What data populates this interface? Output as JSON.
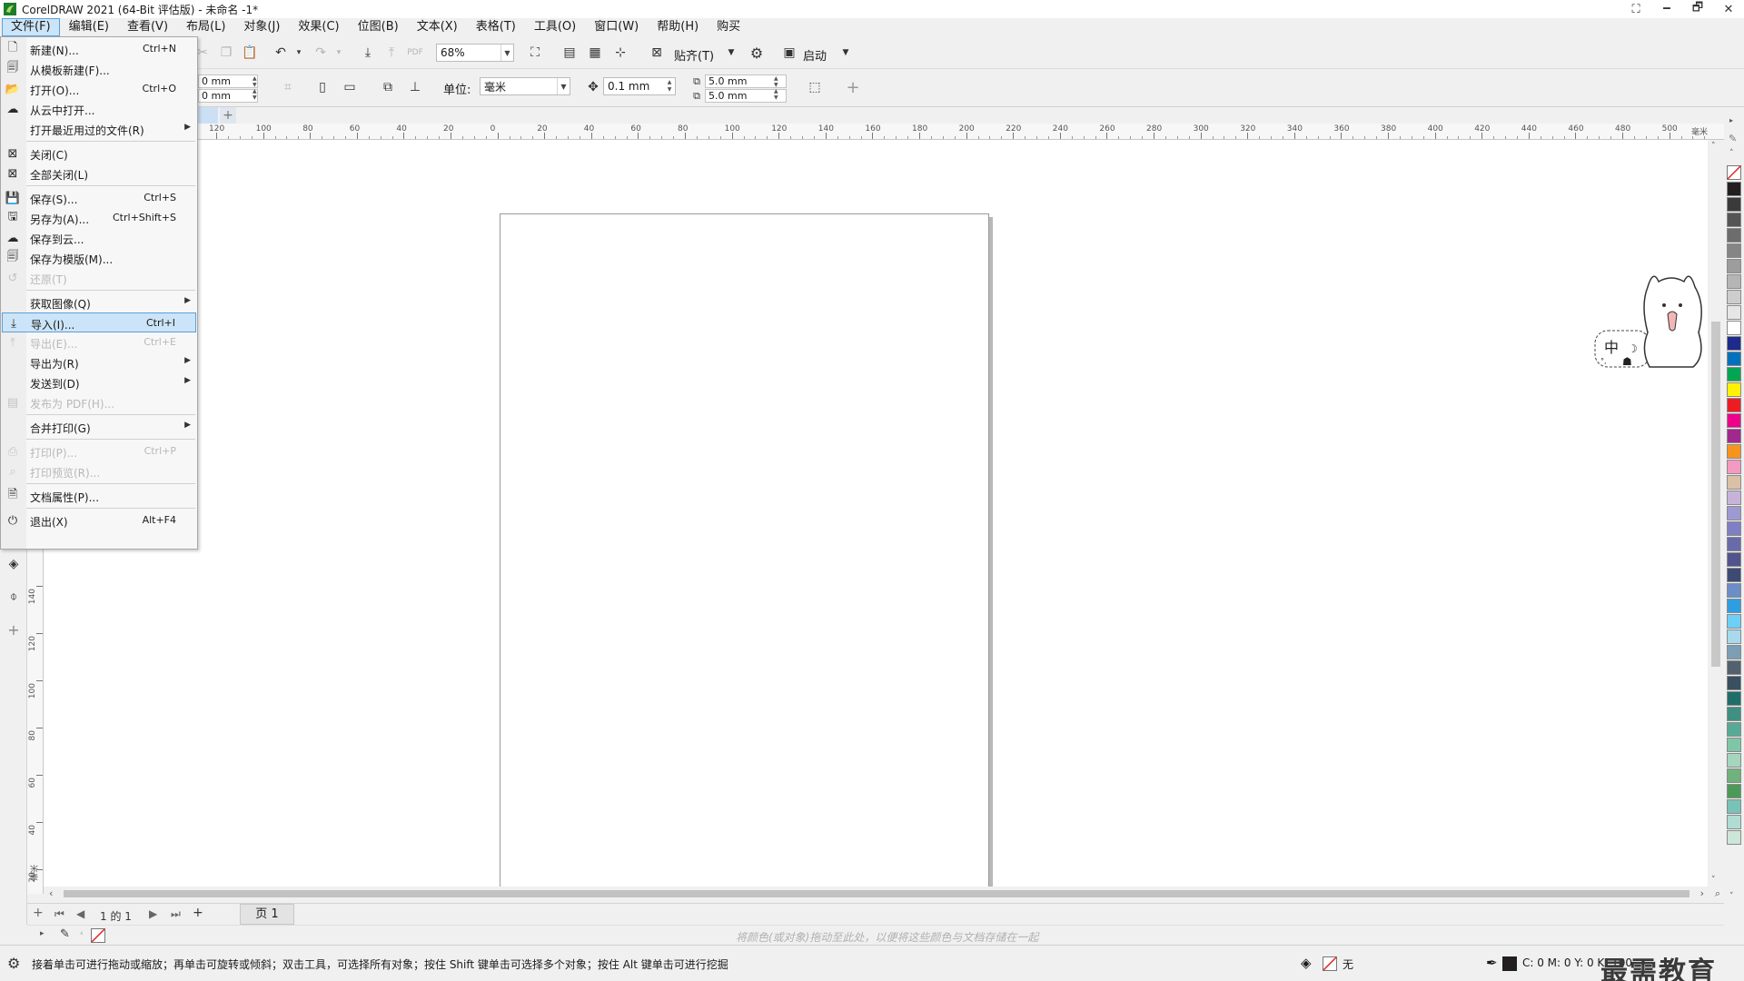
{
  "window": {
    "title": "CorelDRAW 2021 (64-Bit 评估版) - 未命名 -1*",
    "minimize": "🗕",
    "restore": "🗗",
    "close": "✕"
  },
  "menubar": {
    "items": [
      {
        "label": "文件(F)"
      },
      {
        "label": "编辑(E)"
      },
      {
        "label": "查看(V)"
      },
      {
        "label": "布局(L)"
      },
      {
        "label": "对象(J)"
      },
      {
        "label": "效果(C)"
      },
      {
        "label": "位图(B)"
      },
      {
        "label": "文本(X)"
      },
      {
        "label": "表格(T)"
      },
      {
        "label": "工具(O)"
      },
      {
        "label": "窗口(W)"
      },
      {
        "label": "帮助(H)"
      },
      {
        "label": "购买"
      }
    ]
  },
  "toolbar": {
    "zoom": "68%",
    "snap_label": "贴齐(T)",
    "launch_label": "启动"
  },
  "propertybar": {
    "x_value": "0 mm",
    "y_value": "0 mm",
    "unit_label": "单位:",
    "unit_value": "毫米",
    "nudge_value": "0.1 mm",
    "dup_x": "5.0 mm",
    "dup_y": "5.0 mm"
  },
  "ruler": {
    "h_ticks": [
      "120",
      "100",
      "80",
      "60",
      "40",
      "20",
      "0",
      "20",
      "40",
      "60",
      "80",
      "100",
      "120",
      "140",
      "160",
      "180",
      "200",
      "220",
      "240",
      "260",
      "280",
      "300",
      "320",
      "340",
      "360",
      "380",
      "400",
      "420",
      "440",
      "460",
      "480",
      "500"
    ],
    "h_unit": "毫米",
    "v_ticks": [
      "140",
      "120",
      "100",
      "80",
      "60",
      "40",
      "20"
    ],
    "v_unit": "毫米"
  },
  "file_menu": {
    "items": [
      {
        "icon": "new-doc-icon",
        "label": "新建(N)...",
        "shortcut": "Ctrl+N",
        "submenu": false,
        "disabled": false
      },
      {
        "icon": "new-from-template-icon",
        "label": "从模板新建(F)...",
        "shortcut": "",
        "submenu": false,
        "disabled": false
      },
      {
        "icon": "open-folder-icon",
        "label": "打开(O)...",
        "shortcut": "Ctrl+O",
        "submenu": false,
        "disabled": false
      },
      {
        "icon": "cloud-open-icon",
        "label": "从云中打开...",
        "shortcut": "",
        "submenu": false,
        "disabled": false
      },
      {
        "icon": "",
        "label": "打开最近用过的文件(R)",
        "shortcut": "",
        "submenu": true,
        "disabled": false
      },
      {
        "separator": true
      },
      {
        "icon": "close-doc-icon",
        "label": "关闭(C)",
        "shortcut": "",
        "submenu": false,
        "disabled": false
      },
      {
        "icon": "close-all-icon",
        "label": "全部关闭(L)",
        "shortcut": "",
        "submenu": false,
        "disabled": false
      },
      {
        "separator": true
      },
      {
        "icon": "save-icon",
        "label": "保存(S)...",
        "shortcut": "Ctrl+S",
        "submenu": false,
        "disabled": false
      },
      {
        "icon": "save-as-icon",
        "label": "另存为(A)...",
        "shortcut": "Ctrl+Shift+S",
        "submenu": false,
        "disabled": false
      },
      {
        "icon": "cloud-save-icon",
        "label": "保存到云...",
        "shortcut": "",
        "submenu": false,
        "disabled": false
      },
      {
        "icon": "save-template-icon",
        "label": "保存为模版(M)...",
        "shortcut": "",
        "submenu": false,
        "disabled": false
      },
      {
        "icon": "revert-icon",
        "label": "还原(T)",
        "shortcut": "",
        "submenu": false,
        "disabled": true
      },
      {
        "separator": true
      },
      {
        "icon": "",
        "label": "获取图像(Q)",
        "shortcut": "",
        "submenu": true,
        "disabled": false
      },
      {
        "icon": "import-icon",
        "label": "导入(I)...",
        "shortcut": "Ctrl+I",
        "submenu": false,
        "disabled": false,
        "highlighted": true
      },
      {
        "icon": "export-icon",
        "label": "导出(E)...",
        "shortcut": "Ctrl+E",
        "submenu": false,
        "disabled": true
      },
      {
        "icon": "",
        "label": "导出为(R)",
        "shortcut": "",
        "submenu": true,
        "disabled": false
      },
      {
        "icon": "",
        "label": "发送到(D)",
        "shortcut": "",
        "submenu": true,
        "disabled": false
      },
      {
        "icon": "pdf-icon",
        "label": "发布为 PDF(H)...",
        "shortcut": "",
        "submenu": false,
        "disabled": true
      },
      {
        "separator": true
      },
      {
        "icon": "",
        "label": "合并打印(G)",
        "shortcut": "",
        "submenu": true,
        "disabled": false
      },
      {
        "separator": true
      },
      {
        "icon": "print-icon",
        "label": "打印(P)...",
        "shortcut": "Ctrl+P",
        "submenu": false,
        "disabled": true
      },
      {
        "icon": "print-preview-icon",
        "label": "打印预览(R)...",
        "shortcut": "",
        "submenu": false,
        "disabled": true
      },
      {
        "separator": true
      },
      {
        "icon": "doc-properties-icon",
        "label": "文档属性(P)...",
        "shortcut": "",
        "submenu": false,
        "disabled": false
      },
      {
        "separator": true
      },
      {
        "icon": "power-icon",
        "label": "退出(X)",
        "shortcut": "Alt+F4",
        "submenu": false,
        "disabled": false
      }
    ]
  },
  "page_nav": {
    "page_info": "1 的 1",
    "page_tab": "页 1"
  },
  "color_hint": "将颜色(或对象)拖动至此处，以便将这些颜色与文档存储在一起",
  "status": {
    "hint": "接着单击可进行拖动或缩放；再单击可旋转或倾斜；双击工具，可选择所有对象；按住 Shift 键单击可选择多个对象；按住 Alt 键单击可进行挖掘",
    "fill_label": "无",
    "cmyk": "C: 0 M: 0 Y: 0 K: 100"
  },
  "sticker": {
    "text": "中"
  },
  "watermark": "最需教育",
  "palette": [
    "#231f20",
    "#3a3a3a",
    "#555555",
    "#6d6d6d",
    "#858585",
    "#9d9d9d",
    "#b5b5b5",
    "#cdcdcd",
    "#e6e6e6",
    "#ffffff",
    "#1d2b8c",
    "#0071bc",
    "#00a651",
    "#fff200",
    "#ed1c24",
    "#ec008c",
    "#a1288c",
    "#f7941d",
    "#f49ac1",
    "#d9c0a6",
    "#c7b3d9",
    "#9e9ad1",
    "#7f7fc4",
    "#6a6aa8",
    "#51548c",
    "#3d4a74",
    "#6b8ec8",
    "#2e9ee3",
    "#6ecff6",
    "#a8d9ec",
    "#7c9eb5",
    "#52616d",
    "#3a4f5f",
    "#1f6f68",
    "#3f8f82",
    "#56ab97",
    "#7fc6a8",
    "#a4d6be",
    "#6fb27b",
    "#4c9a57",
    "#79c2b8",
    "#b0dcd3",
    "#cde6d9"
  ]
}
